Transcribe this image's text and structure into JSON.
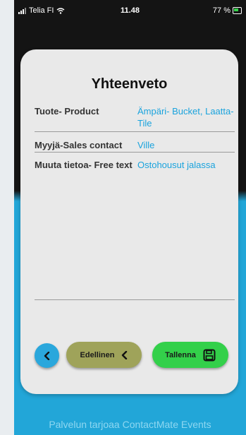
{
  "status_bar": {
    "carrier": "Telia FI",
    "time": "11.48",
    "battery": "77 %"
  },
  "summary": {
    "title": "Yhteenveto",
    "rows": [
      {
        "label": "Tuote- Product",
        "value": "Ämpäri- Bucket, Laatta- Tile"
      },
      {
        "label": "Myyjä-Sales contact",
        "value": "Ville"
      },
      {
        "label": "Muuta tietoa- Free text",
        "value": "Ostohousut jalassa"
      }
    ]
  },
  "buttons": {
    "previous_label": "Edellinen",
    "save_label": "Tallenna"
  },
  "footer": "Palvelun tarjoaa ContactMate Events",
  "colors": {
    "accent_blue": "#22a6d8",
    "save_green": "#33d04a",
    "prev_olive": "#9fa35a"
  }
}
